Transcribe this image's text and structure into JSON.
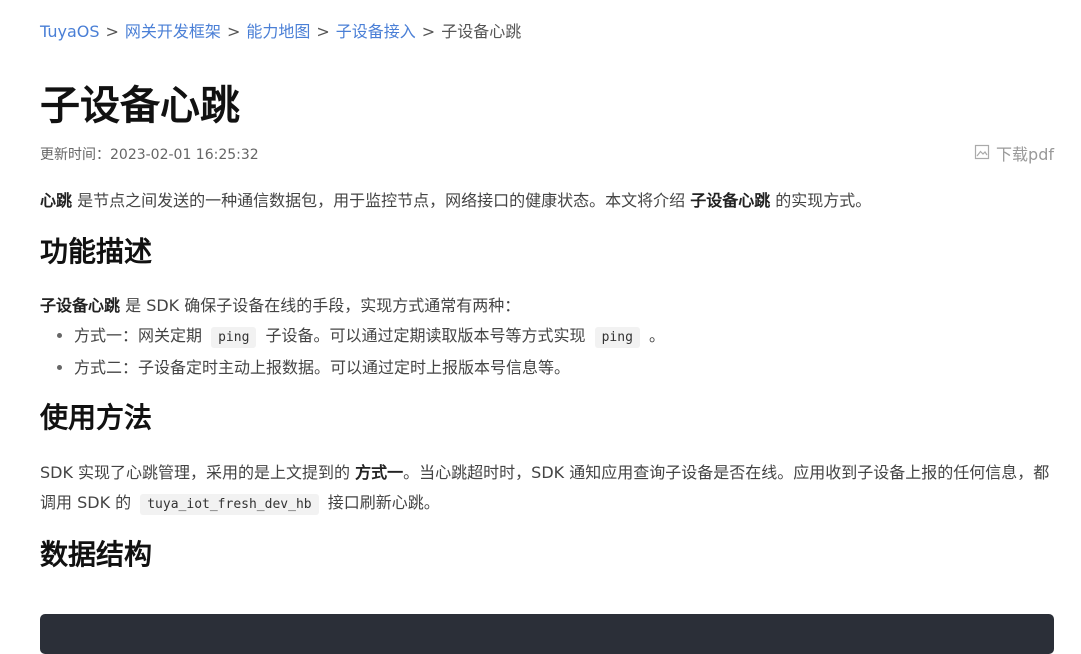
{
  "breadcrumb": {
    "items": [
      "TuyaOS",
      "网关开发框架",
      "能力地图",
      "子设备接入"
    ],
    "separator": ">",
    "current": "子设备心跳"
  },
  "title": "子设备心跳",
  "updated": "更新时间：2023-02-01 16:25:32",
  "download": {
    "label": "下载pdf",
    "icon": "pdf-download-icon"
  },
  "intro": {
    "b1": "心跳",
    "t1": " 是节点之间发送的一种通信数据包，用于监控节点，网络接口的健康状态。本文将介绍 ",
    "b2": "子设备心跳",
    "t2": " 的实现方式。"
  },
  "sections": {
    "func": {
      "heading": "功能描述",
      "b1": "子设备心跳",
      "t1": " 是 SDK 确保子设备在线的手段，实现方式通常有两种：",
      "li1": {
        "t1": "方式一：网关定期 ",
        "code1": "ping",
        "t2": " 子设备。可以通过定期读取版本号等方式实现 ",
        "code2": "ping",
        "t3": " 。"
      },
      "li2": {
        "t1": "方式二：子设备定时主动上报数据。可以通过定时上报版本号信息等。"
      }
    },
    "usage": {
      "heading": "使用方法",
      "t1": "SDK 实现了心跳管理，采用的是上文提到的 ",
      "b1": "方式一",
      "t2": "。当心跳超时时，SDK 通知应用查询子设备是否在线。应用收到子设备上报的任何信息，都调用 SDK 的 ",
      "code1": "tuya_iot_fresh_dev_hb",
      "t3": " 接口刷新心跳。"
    },
    "data": {
      "heading": "数据结构"
    }
  },
  "colors": {
    "link": "#4a7fd6",
    "code_block_bg": "#2b2f38"
  }
}
